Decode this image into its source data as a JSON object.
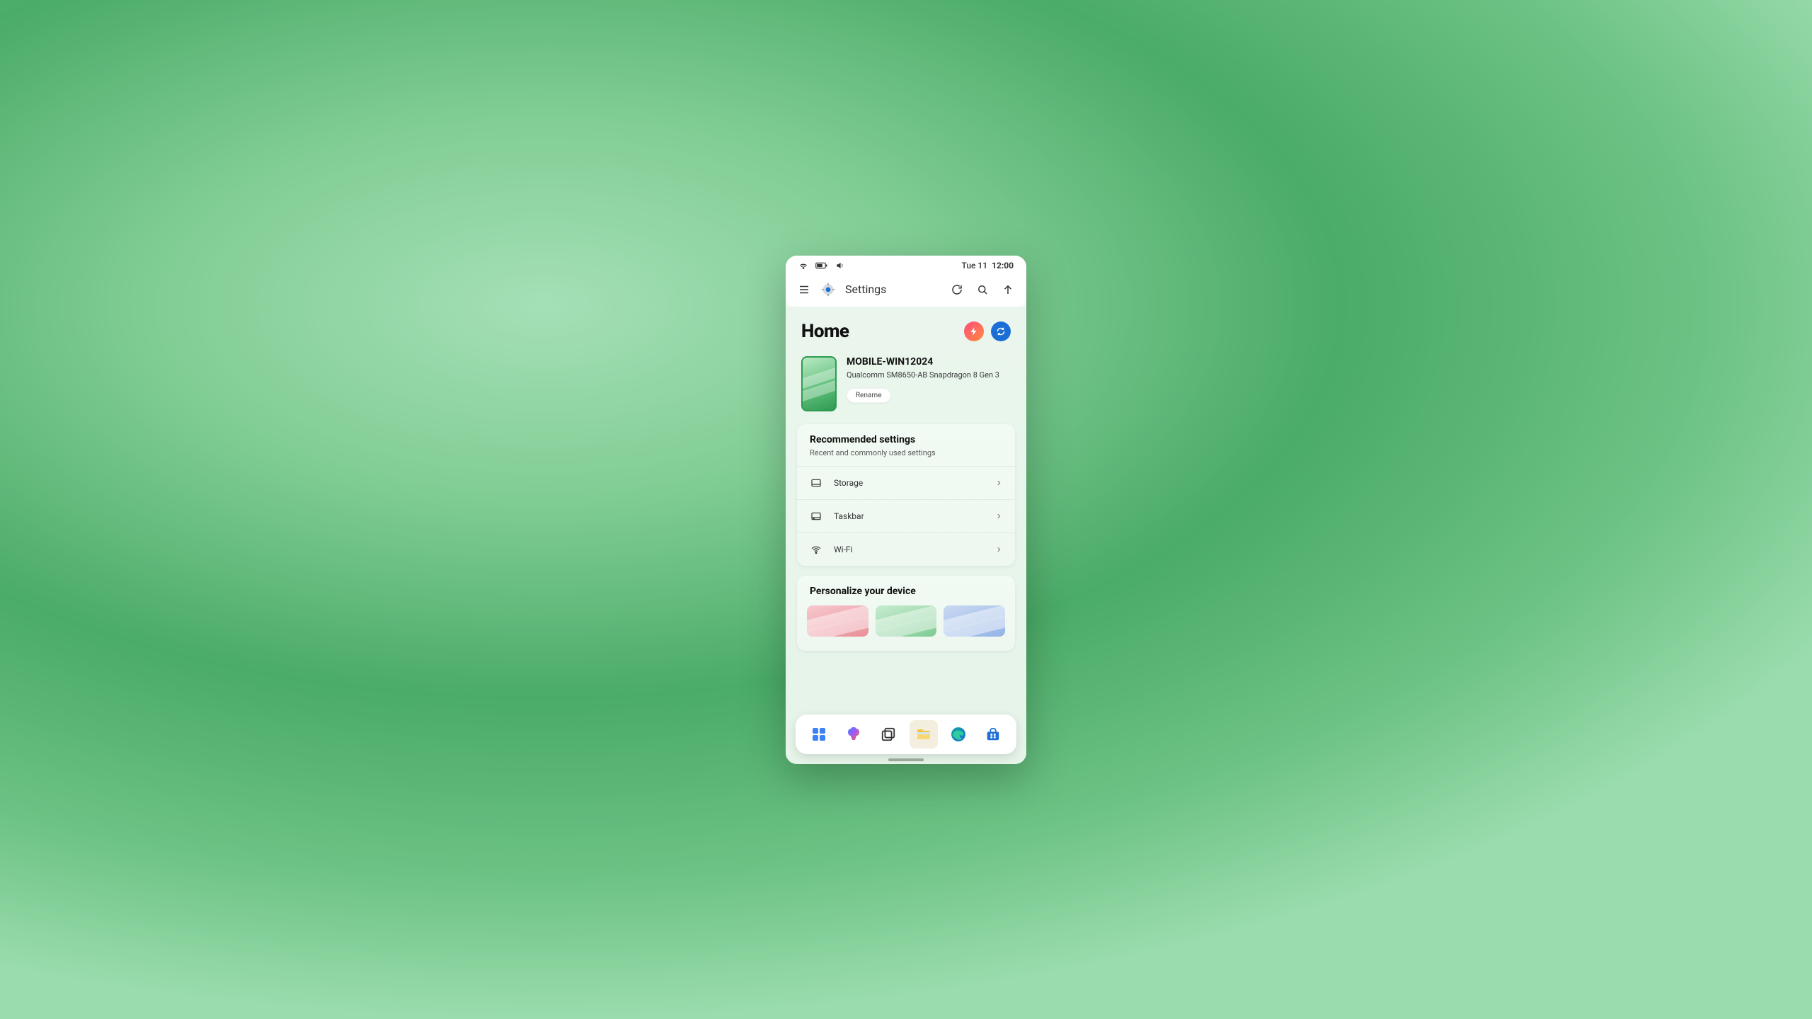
{
  "status": {
    "date": "Tue 11",
    "time": "12:00"
  },
  "header": {
    "title": "Settings"
  },
  "home": {
    "title": "Home"
  },
  "device": {
    "name": "MOBILE-WIN12024",
    "subtitle": "Qualcomm SM8650-AB Snapdragon 8 Gen 3",
    "rename_label": "Rename"
  },
  "recommended": {
    "title": "Recommended settings",
    "subtitle": "Recent and commonly used settings",
    "items": [
      {
        "label": "Storage"
      },
      {
        "label": "Taskbar"
      },
      {
        "label": "Wi-Fi"
      }
    ]
  },
  "personalize": {
    "title": "Personalize your device"
  }
}
